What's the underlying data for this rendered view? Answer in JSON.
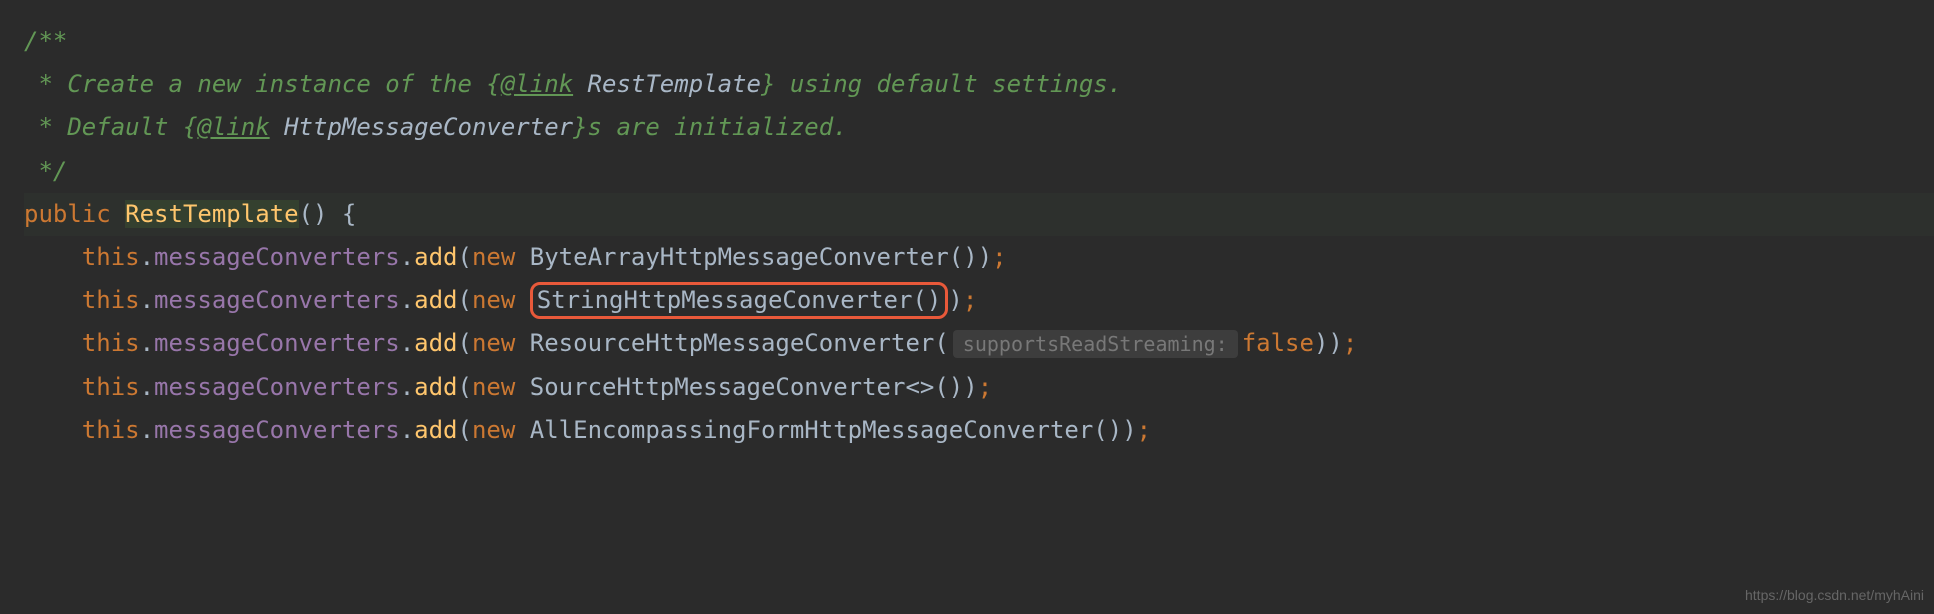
{
  "javadoc": {
    "open": "/**",
    "line1_prefix": " * ",
    "line1_text": "Create a new instance of the ",
    "line1_link_open": "{",
    "line1_link_tag": "@link",
    "line1_link_text": " RestTemplate",
    "line1_link_close": "}",
    "line1_suffix": " using default settings.",
    "line2_prefix": " * ",
    "line2_text": "Default ",
    "line2_link_open": "{",
    "line2_link_tag": "@link",
    "line2_link_text": " HttpMessageConverter",
    "line2_link_close": "}",
    "line2_suffix": "s are initialized.",
    "close": " */"
  },
  "constructor": {
    "modifier": "public",
    "name": "RestTemplate",
    "parens": "() ",
    "brace": "{"
  },
  "lines": {
    "indent": "    ",
    "this": "this",
    "dot": ".",
    "field": "messageConverters",
    "method": "add",
    "paren_open": "(",
    "paren_close": ")",
    "paren_close2": "))",
    "semicolon": ";",
    "new": "new",
    "space": " ",
    "class1": "ByteArrayHttpMessageConverter",
    "class1_call": "()",
    "class2": "StringHttpMessageConverter",
    "class2_call": "()",
    "class3": "ResourceHttpMessageConverter",
    "class3_hint": "supportsReadStreaming:",
    "class3_val": "false",
    "class4": "SourceHttpMessageConverter",
    "class4_generics": "<>",
    "class4_call": "()",
    "class5": "AllEncompassingFormHttpMessageConverter",
    "class5_call": "()"
  },
  "watermark": "https://blog.csdn.net/myhAini"
}
